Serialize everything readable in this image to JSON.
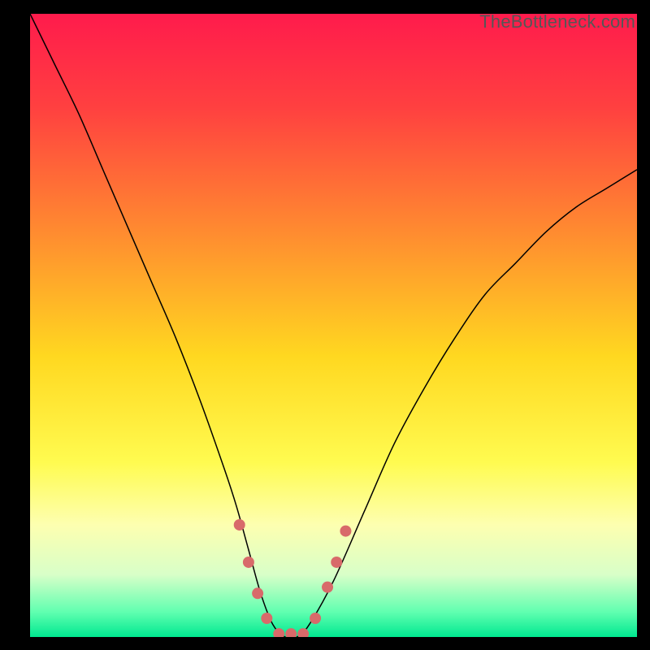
{
  "watermark": "TheBottleneck.com",
  "chart_data": {
    "type": "line",
    "title": "",
    "xlabel": "",
    "ylabel": "",
    "xlim": [
      0,
      100
    ],
    "ylim": [
      0,
      100
    ],
    "background_gradient": {
      "type": "vertical",
      "stops": [
        {
          "pos": 0.0,
          "color": "#ff1b4c"
        },
        {
          "pos": 0.15,
          "color": "#ff4040"
        },
        {
          "pos": 0.35,
          "color": "#ff8b30"
        },
        {
          "pos": 0.55,
          "color": "#ffd820"
        },
        {
          "pos": 0.72,
          "color": "#fffb50"
        },
        {
          "pos": 0.82,
          "color": "#fdffb0"
        },
        {
          "pos": 0.9,
          "color": "#d8ffc8"
        },
        {
          "pos": 0.96,
          "color": "#60ffb0"
        },
        {
          "pos": 1.0,
          "color": "#00e890"
        }
      ]
    },
    "series": [
      {
        "name": "bottleneck-curve",
        "color": "#000000",
        "width": 1.5,
        "x": [
          0,
          4,
          8,
          12,
          16,
          20,
          24,
          28,
          32,
          34,
          36,
          38,
          40,
          42,
          44,
          46,
          50,
          55,
          60,
          65,
          70,
          75,
          80,
          85,
          90,
          95,
          100
        ],
        "y": [
          100,
          92,
          84,
          75,
          66,
          57,
          48,
          38,
          27,
          21,
          14,
          7,
          2,
          0,
          0,
          2,
          9,
          20,
          31,
          40,
          48,
          55,
          60,
          65,
          69,
          72,
          75
        ]
      }
    ],
    "markers": {
      "name": "bottom-dots",
      "color": "#d86a6a",
      "radius": 7,
      "points": [
        {
          "x": 34.5,
          "y": 18
        },
        {
          "x": 36.0,
          "y": 12
        },
        {
          "x": 37.5,
          "y": 7
        },
        {
          "x": 39.0,
          "y": 3
        },
        {
          "x": 41.0,
          "y": 0.5
        },
        {
          "x": 43.0,
          "y": 0.5
        },
        {
          "x": 45.0,
          "y": 0.5
        },
        {
          "x": 47.0,
          "y": 3
        },
        {
          "x": 49.0,
          "y": 8
        },
        {
          "x": 50.5,
          "y": 12
        },
        {
          "x": 52.0,
          "y": 17
        }
      ]
    }
  }
}
